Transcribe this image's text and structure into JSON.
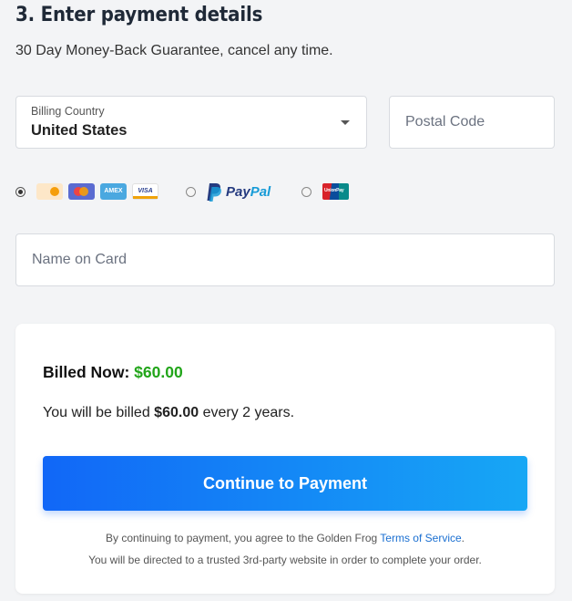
{
  "section": {
    "title": "3. Enter payment details",
    "subtitle": "30 Day Money-Back Guarantee, cancel any time."
  },
  "billing_country": {
    "label": "Billing Country",
    "value": "United States"
  },
  "postal_code": {
    "placeholder": "Postal Code"
  },
  "payment_methods": {
    "selected": "card",
    "card_logos": [
      "discover-icon",
      "mastercard-icon",
      "amex-icon",
      "visa-icon"
    ],
    "amex_text": "AMEX",
    "visa_text": "VISA",
    "paypal_text_1": "Pay",
    "paypal_text_2": "Pal",
    "unionpay_text": "UnionPay"
  },
  "name_on_card": {
    "placeholder": "Name on Card"
  },
  "summary": {
    "billed_now_label": "Billed Now:",
    "billed_now_amount": "$60.00",
    "billing_prefix": "You will be billed",
    "billing_amount": "$60.00",
    "billing_suffix": "every 2 years.",
    "cta_label": "Continue to Payment",
    "legal_prefix": "By continuing to payment, you agree to the Golden Frog",
    "legal_link": "Terms of Service",
    "legal_suffix": ".",
    "redirect_notice": "You will be directed to a trusted 3rd-party website in order to complete your order."
  },
  "colors": {
    "accent_green": "#22a51a",
    "button_gradient_start": "#1167f7",
    "button_gradient_end": "#17a7f5",
    "link": "#1a6fd1"
  }
}
